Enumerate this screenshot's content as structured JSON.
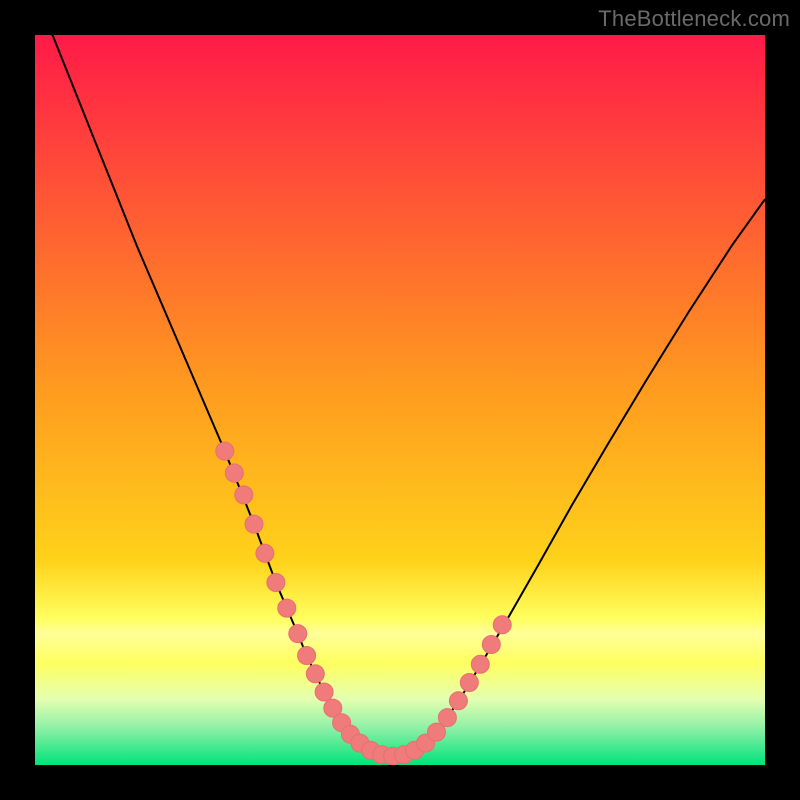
{
  "attribution": "TheBottleneck.com",
  "colors": {
    "frame": "#000000",
    "gradient_top": "#ff1a48",
    "gradient_mid": "#ffd21a",
    "gradient_low1": "#ffff9a",
    "gradient_low2": "#e4ffb0",
    "gradient_bottom": "#00e37a",
    "curve": "#000000",
    "marker_fill": "#ef7b7b",
    "marker_stroke": "#e86f6f"
  },
  "chart_data": {
    "type": "line",
    "title": "",
    "xlabel": "",
    "ylabel": "",
    "xlim": [
      0,
      1
    ],
    "ylim": [
      0,
      1
    ],
    "legend": false,
    "note": "Axes are normalized to plot area; actual units not shown on image.",
    "series": [
      {
        "name": "curve",
        "x": [
          0.02,
          0.05,
          0.08,
          0.11,
          0.14,
          0.17,
          0.2,
          0.23,
          0.26,
          0.28,
          0.3,
          0.315,
          0.33,
          0.345,
          0.36,
          0.372,
          0.384,
          0.396,
          0.408,
          0.42,
          0.432,
          0.445,
          0.46,
          0.475,
          0.49,
          0.505,
          0.52,
          0.54,
          0.56,
          0.585,
          0.615,
          0.65,
          0.69,
          0.735,
          0.785,
          0.838,
          0.895,
          0.955,
          1.0
        ],
        "y": [
          1.01,
          0.935,
          0.86,
          0.785,
          0.71,
          0.64,
          0.57,
          0.5,
          0.43,
          0.38,
          0.33,
          0.29,
          0.25,
          0.215,
          0.18,
          0.15,
          0.125,
          0.1,
          0.078,
          0.058,
          0.042,
          0.03,
          0.02,
          0.014,
          0.012,
          0.014,
          0.02,
          0.035,
          0.058,
          0.095,
          0.145,
          0.205,
          0.275,
          0.355,
          0.44,
          0.528,
          0.62,
          0.712,
          0.775
        ]
      }
    ],
    "markers": {
      "name": "highlight-dots",
      "points": [
        {
          "x": 0.26,
          "y": 0.43
        },
        {
          "x": 0.273,
          "y": 0.4
        },
        {
          "x": 0.286,
          "y": 0.37
        },
        {
          "x": 0.3,
          "y": 0.33
        },
        {
          "x": 0.315,
          "y": 0.29
        },
        {
          "x": 0.33,
          "y": 0.25
        },
        {
          "x": 0.345,
          "y": 0.215
        },
        {
          "x": 0.36,
          "y": 0.18
        },
        {
          "x": 0.372,
          "y": 0.15
        },
        {
          "x": 0.384,
          "y": 0.125
        },
        {
          "x": 0.396,
          "y": 0.1
        },
        {
          "x": 0.408,
          "y": 0.078
        },
        {
          "x": 0.42,
          "y": 0.058
        },
        {
          "x": 0.432,
          "y": 0.042
        },
        {
          "x": 0.445,
          "y": 0.03
        },
        {
          "x": 0.46,
          "y": 0.02
        },
        {
          "x": 0.475,
          "y": 0.014
        },
        {
          "x": 0.49,
          "y": 0.012
        },
        {
          "x": 0.505,
          "y": 0.014
        },
        {
          "x": 0.52,
          "y": 0.02
        },
        {
          "x": 0.535,
          "y": 0.03
        },
        {
          "x": 0.55,
          "y": 0.045
        },
        {
          "x": 0.565,
          "y": 0.065
        },
        {
          "x": 0.58,
          "y": 0.088
        },
        {
          "x": 0.595,
          "y": 0.113
        },
        {
          "x": 0.61,
          "y": 0.138
        },
        {
          "x": 0.625,
          "y": 0.165
        },
        {
          "x": 0.64,
          "y": 0.192
        }
      ]
    },
    "bands": [
      {
        "name": "pale-yellow",
        "y0": 0.165,
        "y1": 0.21,
        "color": "#ffff9a"
      },
      {
        "name": "pale-green",
        "y0": 0.05,
        "y1": 0.095,
        "color": "#e4ffb0"
      }
    ]
  }
}
